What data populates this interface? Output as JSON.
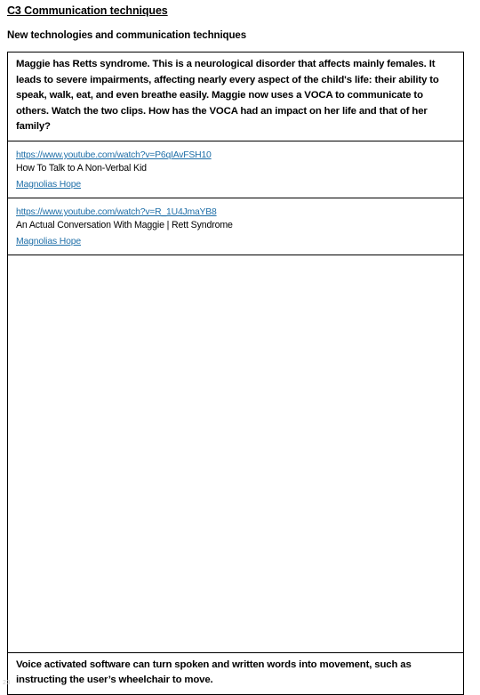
{
  "document": {
    "title": "C3 Communication techniques",
    "subtitle": "New technologies and communication techniques",
    "page_number": "23"
  },
  "prompt": {
    "text": "Maggie has Retts syndrome.  This is a neurological disorder that affects mainly females. It leads to severe impairments, affecting nearly every aspect of the child's life: their ability to speak, walk, eat, and even breathe easily.  Maggie now uses a VOCA to communicate to others. Watch the two clips.  How has the VOCA had an impact on her life and that of her family?"
  },
  "videos": [
    {
      "url": "https://www.youtube.com/watch?v=P6qIAvFSH10",
      "title": "How To Talk to A Non-Verbal Kid",
      "channel": "Magnolias Hope"
    },
    {
      "url": "https://www.youtube.com/watch?v=R_1U4JmaYB8",
      "title": "An Actual Conversation With Maggie | Rett Syndrome",
      "channel": "Magnolias Hope"
    }
  ],
  "answer_area": {
    "placeholder": ""
  },
  "footer": {
    "text": "Voice activated software can turn spoken and written words into movement, such as instructing the user’s wheelchair to move."
  },
  "colors": {
    "link": "#1F6FA8",
    "text": "#000000",
    "border": "#000000",
    "page_number": "#c9c9c9"
  }
}
